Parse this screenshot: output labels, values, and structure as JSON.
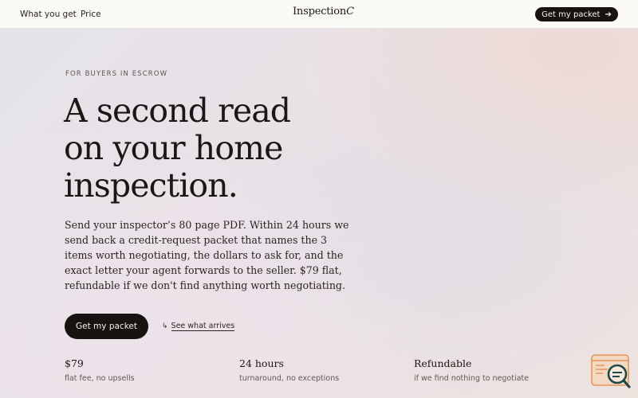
{
  "nav": {
    "links": [
      "What you get",
      "Price"
    ],
    "logo_text": "Inspection",
    "logo_mark": "C",
    "cta_label": "Get my packet",
    "cta_icon": "arrow-right-icon"
  },
  "hero": {
    "eyebrow": "FOR BUYERS IN ESCROW",
    "headline_lines": [
      "A second read",
      "on your home",
      "inspection."
    ],
    "lede": "Send your inspector’s 80 page PDF. Within 24 hours we send back a credit-request packet that names the 3 items worth negotiating, the dollars to ask for, and the exact letter your agent forwards to the seller. $79 flat, refundable if we don't find anything worth negotiating.",
    "primary_cta": "Get my packet",
    "secondary_cta": "See what arrives",
    "secondary_icon": "↳"
  },
  "stats": [
    {
      "value": "$79",
      "caption": "flat fee, no upsells"
    },
    {
      "value": "24 hours",
      "caption": "turnaround, no exceptions"
    },
    {
      "value": "Refundable",
      "caption": "if we find nothing to negotiate"
    }
  ],
  "widget": {
    "icon": "chat-search-icon",
    "colors": {
      "accent": "#e8945a",
      "fill": "#f3d9c2",
      "dark": "#1d4a47"
    }
  }
}
